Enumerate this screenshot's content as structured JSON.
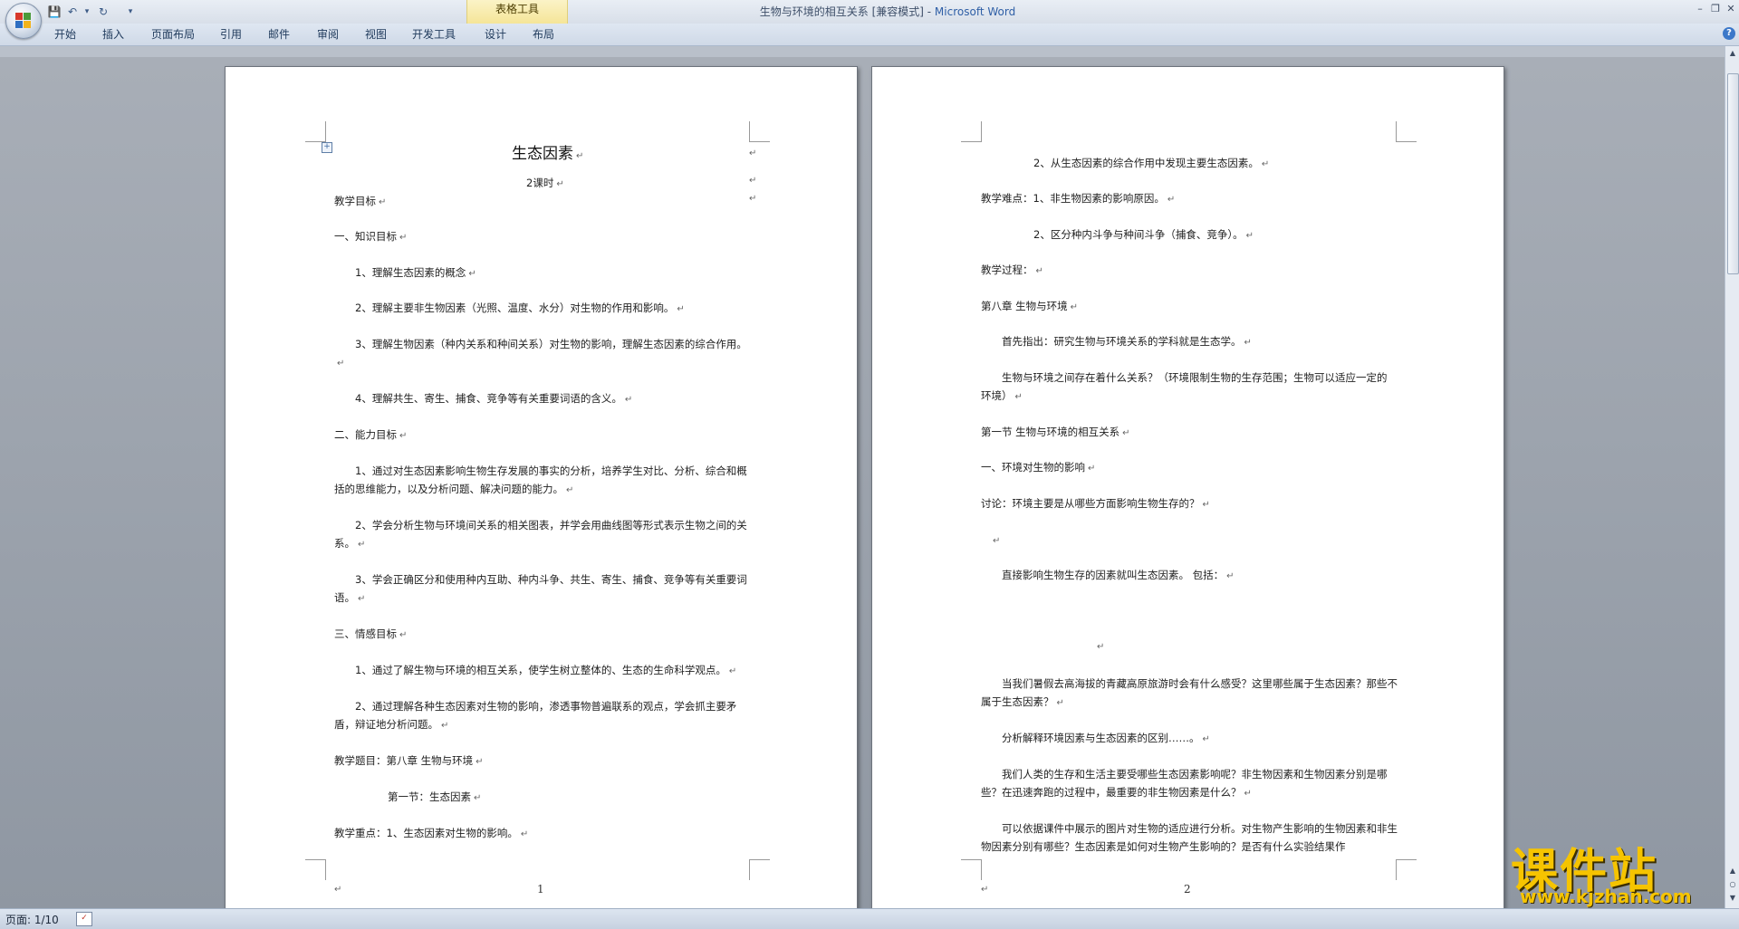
{
  "window": {
    "title": "生物与环境的相互关系 [兼容模式] - ",
    "app_name": "Microsoft Word",
    "context_tab_group": "表格工具",
    "minimize": "–",
    "restore": "❐",
    "close": "✕"
  },
  "quick_access": {
    "save": "💾",
    "undo": "↶",
    "undo_dropdown": "▾",
    "redo": "↻",
    "customize": "▾"
  },
  "ribbon": {
    "tabs": [
      {
        "label": "开始"
      },
      {
        "label": "插入"
      },
      {
        "label": "页面布局"
      },
      {
        "label": "引用"
      },
      {
        "label": "邮件"
      },
      {
        "label": "审阅"
      },
      {
        "label": "视图"
      },
      {
        "label": "开发工具"
      },
      {
        "label": "设计"
      },
      {
        "label": "布局"
      }
    ],
    "help": "?"
  },
  "page1": {
    "title": "生态因素",
    "subtitle": "2课时",
    "paragraphs": [
      "教学目标",
      "一、知识目标",
      "1、理解生态因素的概念",
      "2、理解主要非生物因素（光照、温度、水分）对生物的作用和影响。",
      "3、理解生物因素（种内关系和种间关系）对生物的影响，理解生态因素的综合作用。",
      "4、理解共生、寄生、捕食、竞争等有关重要词语的含义。",
      "二、能力目标",
      "1、通过对生态因素影响生物生存发展的事实的分析，培养学生对比、分析、综合和概括的思维能力，以及分析问题、解决问题的能力。",
      "2、学会分析生物与环境间关系的相关图表，并学会用曲线图等形式表示生物之间的关系。",
      "3、学会正确区分和使用种内互助、种内斗争、共生、寄生、捕食、竞争等有关重要词语。",
      "三、情感目标",
      "1、通过了解生物与环境的相互关系，使学生树立整体的、生态的生命科学观点。",
      "2、通过理解各种生态因素对生物的影响，渗透事物普遍联系的观点，学会抓主要矛盾，辩证地分析问题。",
      "教学题目：第八章 生物与环境",
      "第一节：生态因素",
      "教学重点：1、生态因素对生物的影响。"
    ],
    "page_number": "1"
  },
  "page2": {
    "paragraphs": [
      "2、从生态因素的综合作用中发现主要生态因素。",
      "教学难点：1、非生物因素的影响原因。",
      "2、区分种内斗争与种间斗争（捕食、竞争）。",
      "教学过程：",
      "第八章 生物与环境",
      "首先指出：研究生物与环境关系的学科就是生态学。",
      "生物与环境之间存在着什么关系？（环境限制生物的生存范围；生物可以适应一定的环境）",
      "第一节 生物与环境的相互关系",
      "一、环境对生物的影响",
      "讨论：环境主要是从哪些方面影响生物生存的？",
      "",
      "直接影响生物生存的因素就叫生态因素。 包括：",
      "",
      "当我们暑假去高海拔的青藏高原旅游时会有什么感受？这里哪些属于生态因素？那些不属于生态因素？",
      "分析解释环境因素与生态因素的区别……。",
      "我们人类的生存和生活主要受哪些生态因素影响呢？非生物因素和生物因素分别是哪些？在迅速奔跑的过程中，最重要的非生物因素是什么？",
      "可以依据课件中展示的图片对生物的适应进行分析。对生物产生影响的生物因素和非生物因素分别有哪些？生态因素是如何对生物产生影响的？是否有什么实验结果作"
    ],
    "page_number": "2"
  },
  "marks": {
    "paragraph": "↵",
    "table_anchor": "+"
  },
  "status": {
    "page_info": "页面: 1/10",
    "spell_icon": "✓"
  },
  "watermark": {
    "text": "课件站",
    "url": "www.kjzhan.com"
  },
  "colors": {
    "office_red": "#d7392b",
    "office_green": "#4a9a3a",
    "office_blue": "#2f6fc2",
    "office_yellow": "#f2b31b",
    "watermark_yellow": "#f6c400",
    "context_tab": "#f5e598"
  }
}
